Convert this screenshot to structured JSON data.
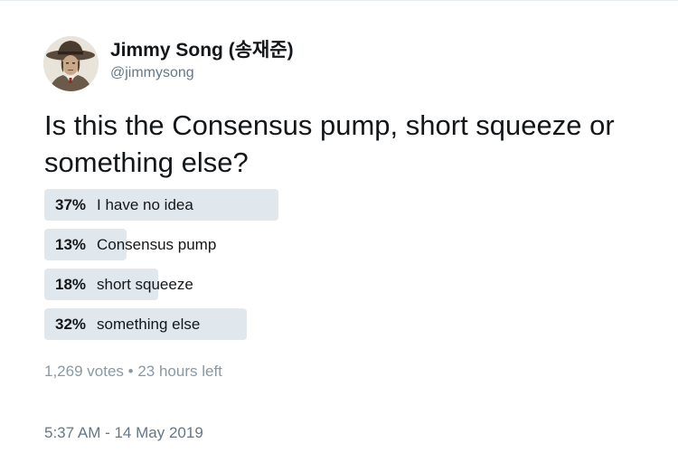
{
  "author": {
    "display_name": "Jimmy Song (송재준)",
    "handle": "@jimmysong"
  },
  "tweet": {
    "text": "Is this the Consensus pump, short squeeze or something else?"
  },
  "poll": {
    "options": [
      {
        "percent_label": "37%",
        "label": "I have no idea",
        "share": 0.37
      },
      {
        "percent_label": "13%",
        "label": "Consensus pump",
        "share": 0.13
      },
      {
        "percent_label": "18%",
        "label": "short squeeze",
        "share": 0.18
      },
      {
        "percent_label": "32%",
        "label": "something else",
        "share": 0.32
      }
    ],
    "votes": "1,269 votes",
    "separator": "•",
    "time_left": "23 hours left"
  },
  "timestamp": "5:37 AM - 14 May 2019",
  "colors": {
    "bar": "#e1e8ed",
    "text": "#14171a",
    "muted": "#8899a6"
  }
}
